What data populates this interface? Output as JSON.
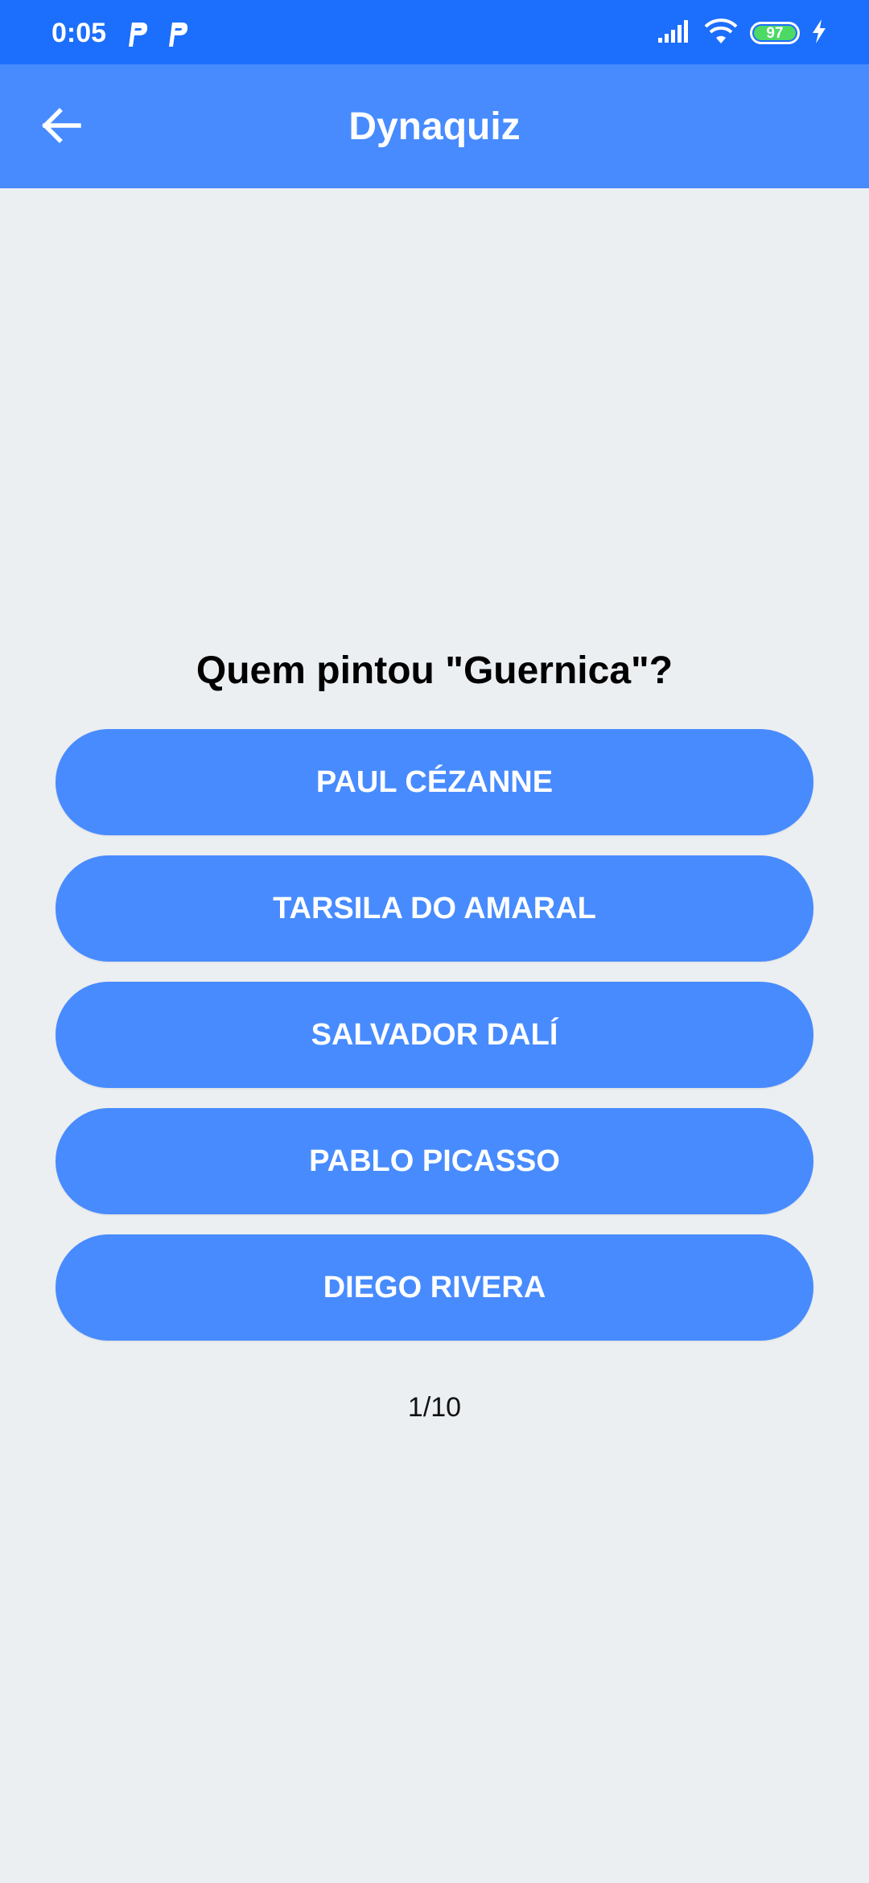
{
  "status_bar": {
    "time": "0:05",
    "notification_icons": [
      "p-app-icon",
      "p-app-icon"
    ],
    "signal_icon": "signal-icon",
    "wifi_icon": "wifi-icon",
    "battery_level": "97",
    "charging_icon": "bolt-icon"
  },
  "app_bar": {
    "title": "Dynaquiz",
    "back_icon": "arrow-left-icon"
  },
  "quiz": {
    "question": "Quem pintou \"Guernica\"?",
    "answers": [
      {
        "label": "PAUL CÉZANNE"
      },
      {
        "label": "TARSILA DO AMARAL"
      },
      {
        "label": "SALVADOR DALÍ"
      },
      {
        "label": "PABLO PICASSO"
      },
      {
        "label": "DIEGO RIVERA"
      }
    ],
    "progress": "1/10"
  },
  "colors": {
    "status_bar": "#1c6efc",
    "app_bar": "#478bff",
    "answer_button": "#478bff",
    "background": "#eceff2",
    "battery_fill": "#4cd964"
  }
}
